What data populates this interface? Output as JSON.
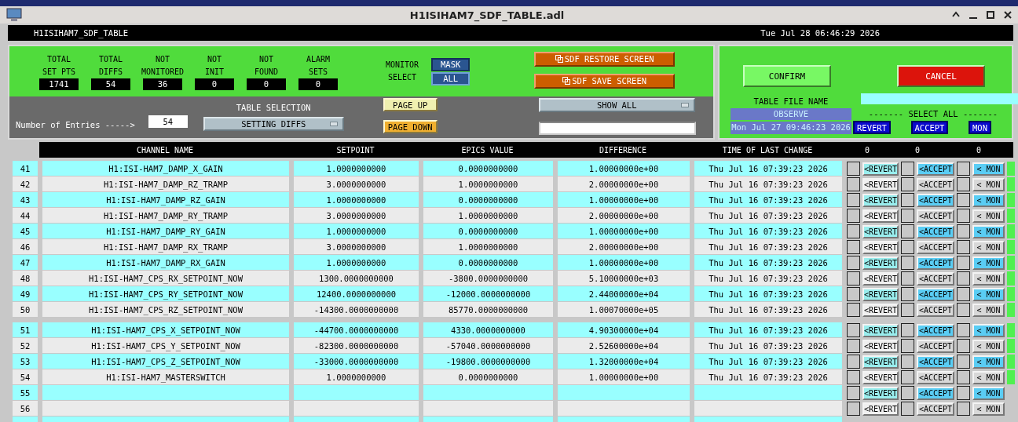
{
  "window": {
    "title": "H1ISIHAM7_SDF_TABLE.adl"
  },
  "header": {
    "name": "H1ISIHAM7_SDF_TABLE",
    "datetime": "Tue Jul 28 06:46:29 2026"
  },
  "stats": [
    {
      "label": "TOTAL\nSET PTS",
      "value": "1741"
    },
    {
      "label": "TOTAL\nDIFFS",
      "value": "54"
    },
    {
      "label": "NOT\nMONITORED",
      "value": "36"
    },
    {
      "label": "NOT\nINIT",
      "value": "0"
    },
    {
      "label": "NOT\nFOUND",
      "value": "0"
    },
    {
      "label": "ALARM\nSETS",
      "value": "0"
    }
  ],
  "monitor_select": {
    "label": "MONITOR\nSELECT",
    "options": [
      {
        "label": "MASK",
        "selected": true
      },
      {
        "label": "ALL",
        "selected": false
      }
    ]
  },
  "screen_buttons": [
    "SDF RESTORE SCREEN",
    "SDF SAVE SCREEN"
  ],
  "entries": {
    "label": "Number of Entries ----->",
    "value": "54"
  },
  "table_selection": {
    "label": "TABLE SELECTION",
    "value": "SETTING DIFFS"
  },
  "paging": [
    "PAGE UP",
    "PAGE DOWN"
  ],
  "show_menu": {
    "value": "SHOW ALL"
  },
  "confirm": "CONFIRM",
  "cancel": "CANCEL",
  "table_file": {
    "label": "TABLE FILE NAME",
    "name": "OBSERVE",
    "date": "Mon Jul 27 09:46:23 2026"
  },
  "select_all": {
    "label": "------- SELECT ALL -------",
    "buttons": [
      "REVERT",
      "ACCEPT",
      "MON"
    ]
  },
  "table": {
    "columns": [
      "CHANNEL NAME",
      "SETPOINT",
      "EPICS VALUE",
      "DIFFERENCE",
      "TIME OF LAST CHANGE"
    ],
    "counts": [
      "0",
      "0",
      "0"
    ],
    "blocks": [
      {
        "rows": [
          {
            "num": "41",
            "channel": "H1:ISI-HAM7_DAMP_X_GAIN",
            "setpoint": "1.0000000000",
            "epics": "0.0000000000",
            "difference": "1.00000000e+00",
            "time": "Thu Jul 16 07:39:23 2026",
            "highlighted": true,
            "monitored": true,
            "actions": [
              "<REVERT",
              "<ACCEPT",
              "< MON"
            ],
            "checked": [
              false,
              false,
              false
            ]
          },
          {
            "num": "42",
            "channel": "H1:ISI-HAM7_DAMP_RZ_TRAMP",
            "setpoint": "3.0000000000",
            "epics": "1.0000000000",
            "difference": "2.00000000e+00",
            "time": "Thu Jul 16 07:39:23 2026",
            "highlighted": false,
            "monitored": true,
            "actions": [
              "<REVERT",
              "<ACCEPT",
              "< MON"
            ],
            "checked": [
              false,
              false,
              false
            ]
          },
          {
            "num": "43",
            "channel": "H1:ISI-HAM7_DAMP_RZ_GAIN",
            "setpoint": "1.0000000000",
            "epics": "0.0000000000",
            "difference": "1.00000000e+00",
            "time": "Thu Jul 16 07:39:23 2026",
            "highlighted": true,
            "monitored": true,
            "actions": [
              "<REVERT",
              "<ACCEPT",
              "< MON"
            ],
            "checked": [
              false,
              false,
              false
            ]
          },
          {
            "num": "44",
            "channel": "H1:ISI-HAM7_DAMP_RY_TRAMP",
            "setpoint": "3.0000000000",
            "epics": "1.0000000000",
            "difference": "2.00000000e+00",
            "time": "Thu Jul 16 07:39:23 2026",
            "highlighted": false,
            "monitored": true,
            "actions": [
              "<REVERT",
              "<ACCEPT",
              "< MON"
            ],
            "checked": [
              false,
              false,
              false
            ]
          },
          {
            "num": "45",
            "channel": "H1:ISI-HAM7_DAMP_RY_GAIN",
            "setpoint": "1.0000000000",
            "epics": "0.0000000000",
            "difference": "1.00000000e+00",
            "time": "Thu Jul 16 07:39:23 2026",
            "highlighted": true,
            "monitored": true,
            "actions": [
              "<REVERT",
              "<ACCEPT",
              "< MON"
            ],
            "checked": [
              false,
              false,
              false
            ]
          },
          {
            "num": "46",
            "channel": "H1:ISI-HAM7_DAMP_RX_TRAMP",
            "setpoint": "3.0000000000",
            "epics": "1.0000000000",
            "difference": "2.00000000e+00",
            "time": "Thu Jul 16 07:39:23 2026",
            "highlighted": false,
            "monitored": true,
            "actions": [
              "<REVERT",
              "<ACCEPT",
              "< MON"
            ],
            "checked": [
              false,
              false,
              false
            ]
          },
          {
            "num": "47",
            "channel": "H1:ISI-HAM7_DAMP_RX_GAIN",
            "setpoint": "1.0000000000",
            "epics": "0.0000000000",
            "difference": "1.00000000e+00",
            "time": "Thu Jul 16 07:39:23 2026",
            "highlighted": true,
            "monitored": true,
            "actions": [
              "<REVERT",
              "<ACCEPT",
              "< MON"
            ],
            "checked": [
              false,
              false,
              false
            ]
          },
          {
            "num": "48",
            "channel": "H1:ISI-HAM7_CPS_RX_SETPOINT_NOW",
            "setpoint": "1300.0000000000",
            "epics": "-3800.0000000000",
            "difference": "5.10000000e+03",
            "time": "Thu Jul 16 07:39:23 2026",
            "highlighted": false,
            "monitored": true,
            "actions": [
              "<REVERT",
              "<ACCEPT",
              "< MON"
            ],
            "checked": [
              false,
              false,
              false
            ]
          },
          {
            "num": "49",
            "channel": "H1:ISI-HAM7_CPS_RY_SETPOINT_NOW",
            "setpoint": "12400.0000000000",
            "epics": "-12000.0000000000",
            "difference": "2.44000000e+04",
            "time": "Thu Jul 16 07:39:23 2026",
            "highlighted": true,
            "monitored": true,
            "actions": [
              "<REVERT",
              "<ACCEPT",
              "< MON"
            ],
            "checked": [
              false,
              false,
              false
            ]
          },
          {
            "num": "50",
            "channel": "H1:ISI-HAM7_CPS_RZ_SETPOINT_NOW",
            "setpoint": "-14300.0000000000",
            "epics": "85770.0000000000",
            "difference": "1.00070000e+05",
            "time": "Thu Jul 16 07:39:23 2026",
            "highlighted": false,
            "monitored": true,
            "actions": [
              "<REVERT",
              "<ACCEPT",
              "< MON"
            ],
            "checked": [
              false,
              false,
              false
            ]
          }
        ]
      },
      {
        "rows": [
          {
            "num": "51",
            "channel": "H1:ISI-HAM7_CPS_X_SETPOINT_NOW",
            "setpoint": "-44700.0000000000",
            "epics": "4330.0000000000",
            "difference": "4.90300000e+04",
            "time": "Thu Jul 16 07:39:23 2026",
            "highlighted": true,
            "monitored": true,
            "actions": [
              "<REVERT",
              "<ACCEPT",
              "< MON"
            ],
            "checked": [
              false,
              false,
              false
            ]
          },
          {
            "num": "52",
            "channel": "H1:ISI-HAM7_CPS_Y_SETPOINT_NOW",
            "setpoint": "-82300.0000000000",
            "epics": "-57040.0000000000",
            "difference": "2.52600000e+04",
            "time": "Thu Jul 16 07:39:23 2026",
            "highlighted": false,
            "monitored": true,
            "actions": [
              "<REVERT",
              "<ACCEPT",
              "< MON"
            ],
            "checked": [
              false,
              false,
              false
            ]
          },
          {
            "num": "53",
            "channel": "H1:ISI-HAM7_CPS_Z_SETPOINT_NOW",
            "setpoint": "-33000.0000000000",
            "epics": "-19800.0000000000",
            "difference": "1.32000000e+04",
            "time": "Thu Jul 16 07:39:23 2026",
            "highlighted": true,
            "monitored": true,
            "actions": [
              "<REVERT",
              "<ACCEPT",
              "< MON"
            ],
            "checked": [
              false,
              false,
              false
            ]
          },
          {
            "num": "54",
            "channel": "H1:ISI-HAM7_MASTERSWITCH",
            "setpoint": "1.0000000000",
            "epics": "0.0000000000",
            "difference": "1.00000000e+00",
            "time": "Thu Jul 16 07:39:23 2026",
            "highlighted": false,
            "monitored": true,
            "actions": [
              "<REVERT",
              "<ACCEPT",
              "< MON"
            ],
            "checked": [
              false,
              false,
              false
            ]
          },
          {
            "num": "55",
            "highlighted": true,
            "monitored": false,
            "actions": [
              "<REVERT",
              "<ACCEPT",
              "< MON"
            ],
            "checked": [
              false,
              false,
              false
            ]
          },
          {
            "num": "56",
            "highlighted": false,
            "monitored": false,
            "actions": [
              "<REVERT",
              "<ACCEPT",
              "< MON"
            ],
            "checked": [
              false,
              false,
              false
            ]
          },
          {
            "highlighted": true,
            "monitored": false
          }
        ]
      }
    ]
  }
}
